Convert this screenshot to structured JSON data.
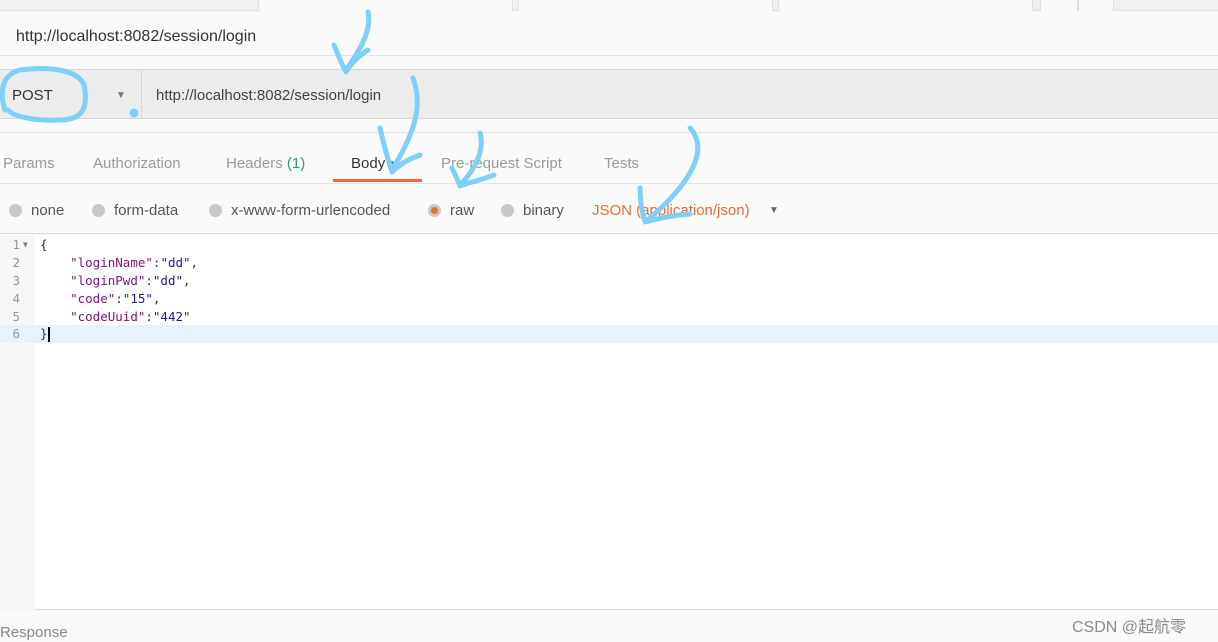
{
  "tab_title": "http://localhost:8082/session/login",
  "request": {
    "method": "POST",
    "url": "http://localhost:8082/session/login"
  },
  "request_tabs": [
    {
      "label": "Params"
    },
    {
      "label": "Authorization"
    },
    {
      "label": "Headers",
      "count": "(1)"
    },
    {
      "label": "Body",
      "active": true
    },
    {
      "label": "Pre-request Script"
    },
    {
      "label": "Tests"
    }
  ],
  "body_modes": [
    {
      "label": "none"
    },
    {
      "label": "form-data"
    },
    {
      "label": "x-www-form-urlencoded"
    },
    {
      "label": "raw",
      "selected": true
    },
    {
      "label": "binary"
    }
  ],
  "content_type": "JSON (application/json)",
  "editor": {
    "line_numbers": [
      "1",
      "2",
      "3",
      "4",
      "5",
      "6"
    ],
    "open_brace": "{",
    "close_brace": "}",
    "fields": [
      {
        "key": "\"loginName\"",
        "value": "\"dd\"",
        "sep": ","
      },
      {
        "key": "\"loginPwd\"",
        "value": "\"dd\"",
        "sep": ","
      },
      {
        "key": "\"code\"",
        "value": "\"15\"",
        "sep": ","
      },
      {
        "key": "\"codeUuid\"",
        "value": "\"442\"",
        "sep": ""
      }
    ]
  },
  "response_label": "Response",
  "watermark": "CSDN @起航零",
  "colors": {
    "accent": "#f06a35",
    "count": "#2ea371",
    "annotation": "#7fd0f8"
  }
}
